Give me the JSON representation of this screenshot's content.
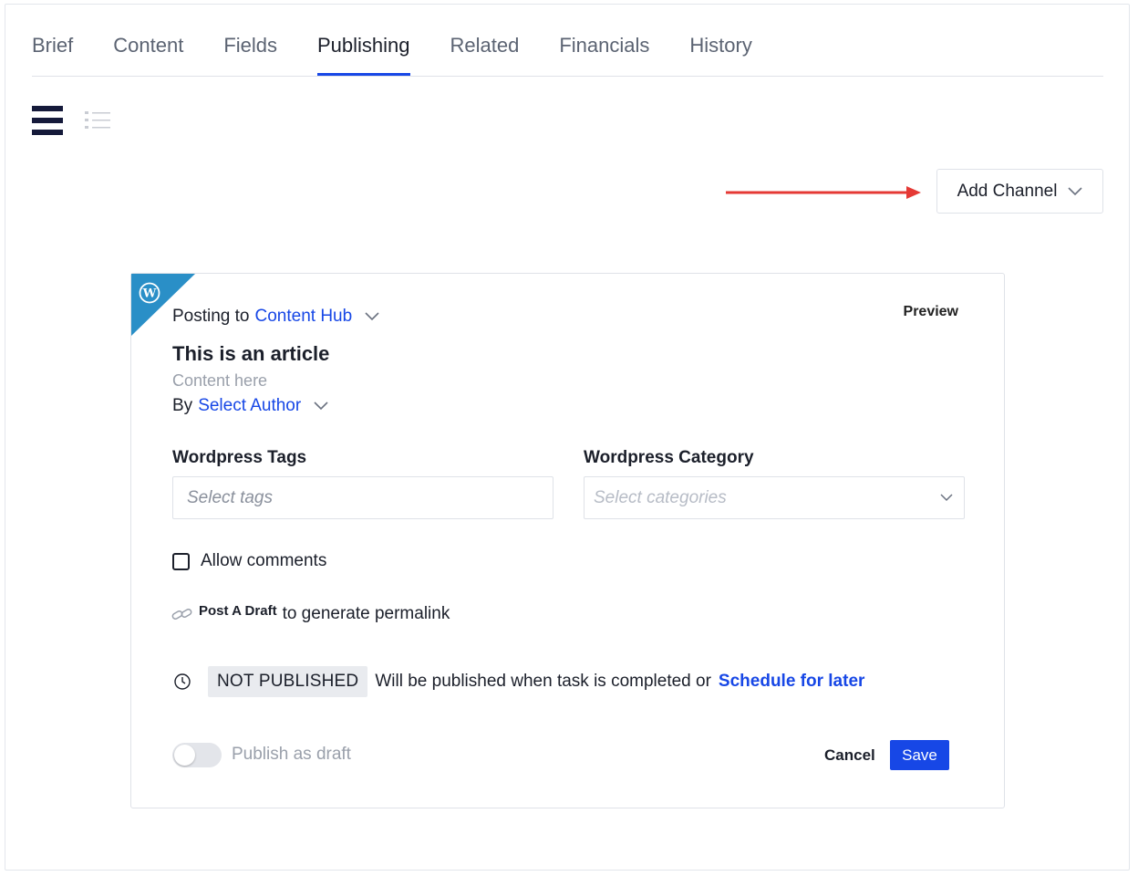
{
  "tabs": [
    {
      "label": "Brief"
    },
    {
      "label": "Content"
    },
    {
      "label": "Fields"
    },
    {
      "label": "Publishing",
      "active": true
    },
    {
      "label": "Related"
    },
    {
      "label": "Financials"
    },
    {
      "label": "History"
    }
  ],
  "view_toggle": {
    "card_view_icon": "card-view-icon",
    "list_view_icon": "list-view-icon"
  },
  "add_channel": {
    "label": "Add Channel",
    "icon": "chevron-down-icon"
  },
  "annotation": {
    "color": "#e53935",
    "icon": "red-arrow"
  },
  "channel_card": {
    "platform_icon": "wordpress-icon",
    "corner_color": "#2a8fc7",
    "posting_prefix": "Posting to",
    "destination": "Content Hub",
    "preview_label": "Preview",
    "article_title": "This is an article",
    "content_placeholder": "Content here",
    "by_prefix": "By",
    "author_link": "Select Author",
    "tags": {
      "label": "Wordpress Tags",
      "placeholder": "Select tags"
    },
    "category": {
      "label": "Wordpress Category",
      "placeholder": "Select categories"
    },
    "allow_comments": {
      "label": "Allow comments",
      "checked": false
    },
    "permalink": {
      "link_icon": "link-icon",
      "action": "Post A Draft",
      "text": "to generate permalink"
    },
    "status": {
      "clock_icon": "clock-icon",
      "badge": "NOT PUBLISHED",
      "message": "Will be published when task is completed or",
      "schedule_link": "Schedule for later"
    },
    "publish_draft": {
      "label": "Publish as draft",
      "on": false
    },
    "cancel_label": "Cancel",
    "save_label": "Save"
  },
  "colors": {
    "accent": "#1747e6",
    "text": "#1b1f2a",
    "muted": "#9aa0ab",
    "border": "#dfe2e8"
  }
}
